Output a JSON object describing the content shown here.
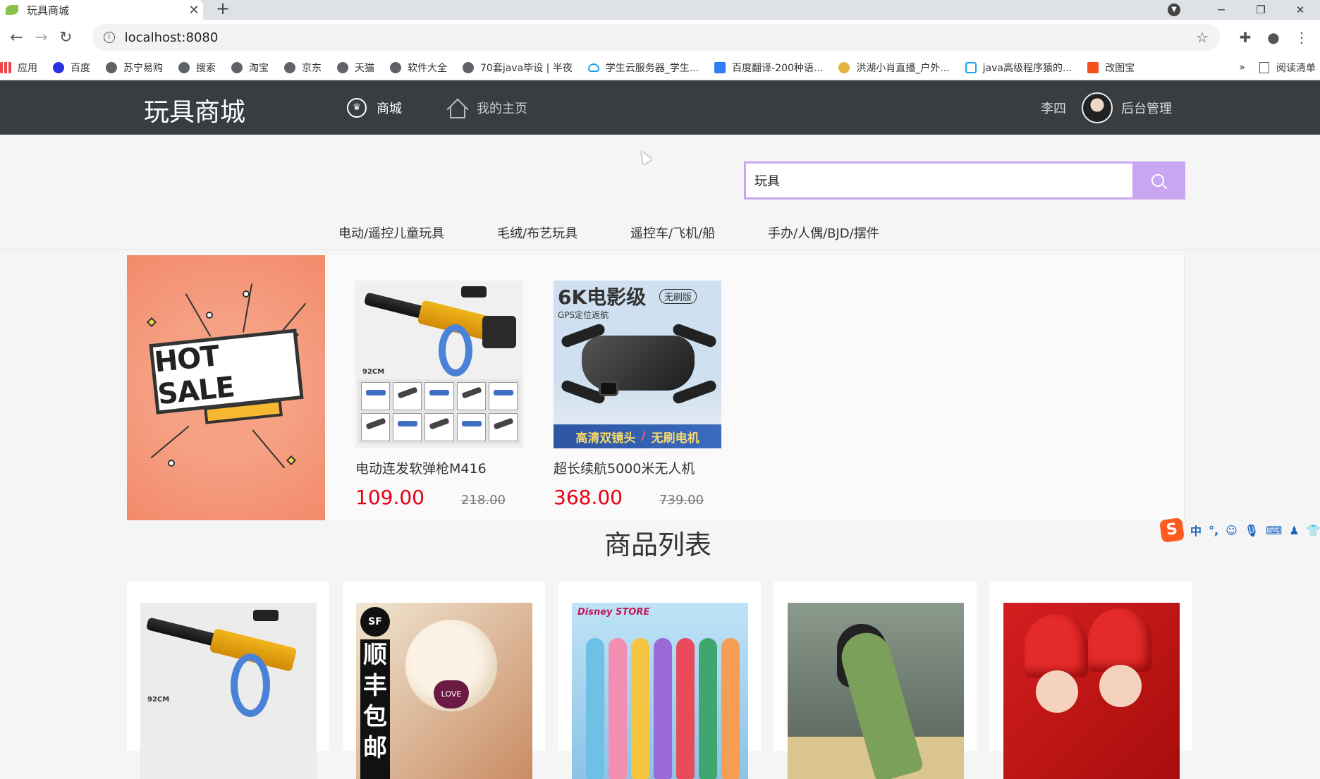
{
  "browser": {
    "tab_title": "玩具商城",
    "tab_close": "✕",
    "new_tab": "+",
    "url": "localhost:8080",
    "bookmarks": [
      {
        "label": "应用",
        "icon": "apps-grid-icon"
      },
      {
        "label": "百度",
        "icon": "baidu-icon"
      },
      {
        "label": "苏宁易购",
        "icon": "globe-icon"
      },
      {
        "label": "搜索",
        "icon": "globe-icon"
      },
      {
        "label": "淘宝",
        "icon": "globe-icon"
      },
      {
        "label": "京东",
        "icon": "globe-icon"
      },
      {
        "label": "天猫",
        "icon": "globe-icon"
      },
      {
        "label": "软件大全",
        "icon": "globe-icon"
      },
      {
        "label": "70套java毕设 | 半夜",
        "icon": "globe-icon"
      },
      {
        "label": "学生云服务器_学生...",
        "icon": "cloud-icon"
      },
      {
        "label": "百度翻译-200种语...",
        "icon": "translate-icon"
      },
      {
        "label": "洪湖小肖直播_户外...",
        "icon": "huya-icon"
      },
      {
        "label": "java高级程序猿的...",
        "icon": "bilibili-icon"
      },
      {
        "label": "改图宝",
        "icon": "gaitubao-icon"
      }
    ],
    "bookmarks_more": "»",
    "reading_list": "阅读清单"
  },
  "header": {
    "logo": "玩具商城",
    "nav": [
      {
        "label": "商城",
        "icon": "crown-icon"
      },
      {
        "label": "我的主页",
        "icon": "home-icon"
      }
    ],
    "username": "李四",
    "admin_link": "后台管理"
  },
  "search": {
    "value": "玩具",
    "placeholder": ""
  },
  "categories": [
    "电动/遥控儿童玩具",
    "毛绒/布艺玩具",
    "遥控车/飞机/船",
    "手办/人偶/BJD/摆件"
  ],
  "promo": {
    "banner_text": "HOT SALE",
    "items": [
      {
        "name": "电动连发软弹枪M416",
        "price": "109.00",
        "old_price": "218.00",
        "image_tag": "92CM"
      },
      {
        "name": "超长续航5000米无人机",
        "price": "368.00",
        "old_price": "739.00",
        "image_title": "6K电影级",
        "image_badge": "无刷版",
        "image_sub": "GPS定位返航",
        "image_footer_left": "高清双镜头",
        "image_footer_sep": "/",
        "image_footer_right": "无刷电机"
      }
    ]
  },
  "section_title": "商品列表",
  "products": [
    {
      "image": "blaster-gun",
      "tag": "92CM"
    },
    {
      "image": "teddy-bear",
      "badge": "SF",
      "badge_text": "顺丰包邮",
      "heart_text": "LOVE"
    },
    {
      "image": "princess-dolls",
      "logo": "Disney STORE"
    },
    {
      "image": "dinosaur-plush"
    },
    {
      "image": "red-cloth-dolls"
    }
  ],
  "ime": {
    "logo": "S",
    "mode": "中",
    "punct": "°,"
  },
  "colors": {
    "header_bg": "#373d41",
    "search_accent": "#c9a6f2",
    "price": "#e60012"
  }
}
